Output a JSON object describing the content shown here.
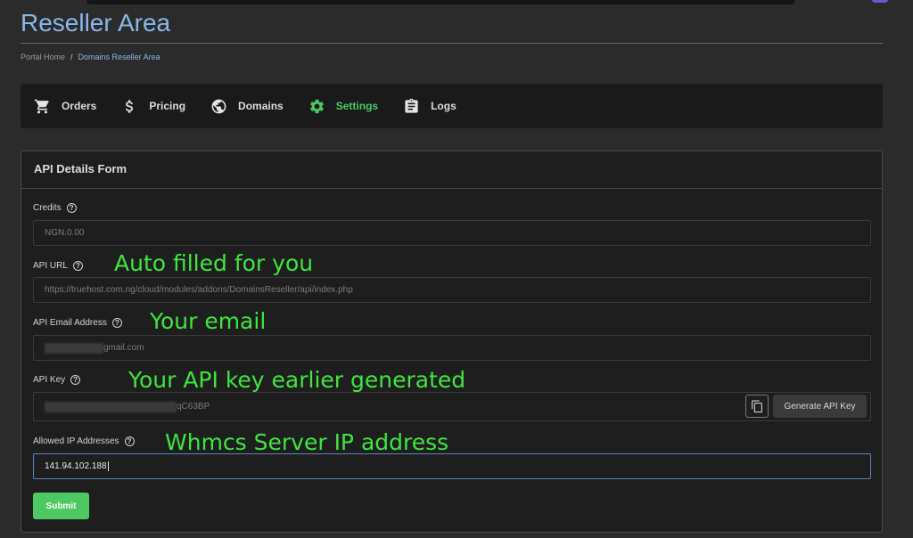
{
  "page": {
    "title": "Reseller Area"
  },
  "breadcrumb": {
    "home": "Portal Home",
    "separator": "/",
    "current": "Domains Reseller Area"
  },
  "nav": {
    "items": [
      {
        "label": "Orders",
        "icon": "cart-icon"
      },
      {
        "label": "Pricing",
        "icon": "dollar-icon"
      },
      {
        "label": "Domains",
        "icon": "globe-icon"
      },
      {
        "label": "Settings",
        "icon": "gear-icon",
        "active": true
      },
      {
        "label": "Logs",
        "icon": "clipboard-icon"
      }
    ]
  },
  "form": {
    "title": "API Details Form",
    "help_symbol": "?",
    "credits": {
      "label": "Credits",
      "value": "NGN.0.00"
    },
    "api_url": {
      "label": "API URL",
      "value": "https://truehost.com.ng/cloud/modules/addons/DomainsReseller/api/index.php"
    },
    "api_email": {
      "label": "API Email Address",
      "value_visible": "gmail.com"
    },
    "api_key": {
      "label": "API Key",
      "value_visible": "qC63BP",
      "generate_label": "Generate API Key"
    },
    "allowed_ip": {
      "label": "Allowed IP Addresses",
      "value": "141.94.102.188"
    },
    "submit_label": "Submit"
  },
  "annotations": {
    "api_url": "Auto filled for you",
    "email": "Your email",
    "api_key": "Your API key earlier generated",
    "ip": "Whmcs Server IP address"
  },
  "colors": {
    "accent_green": "#4cc961",
    "title_blue": "#8ab6e8",
    "annotation_green": "#3ee63e"
  }
}
